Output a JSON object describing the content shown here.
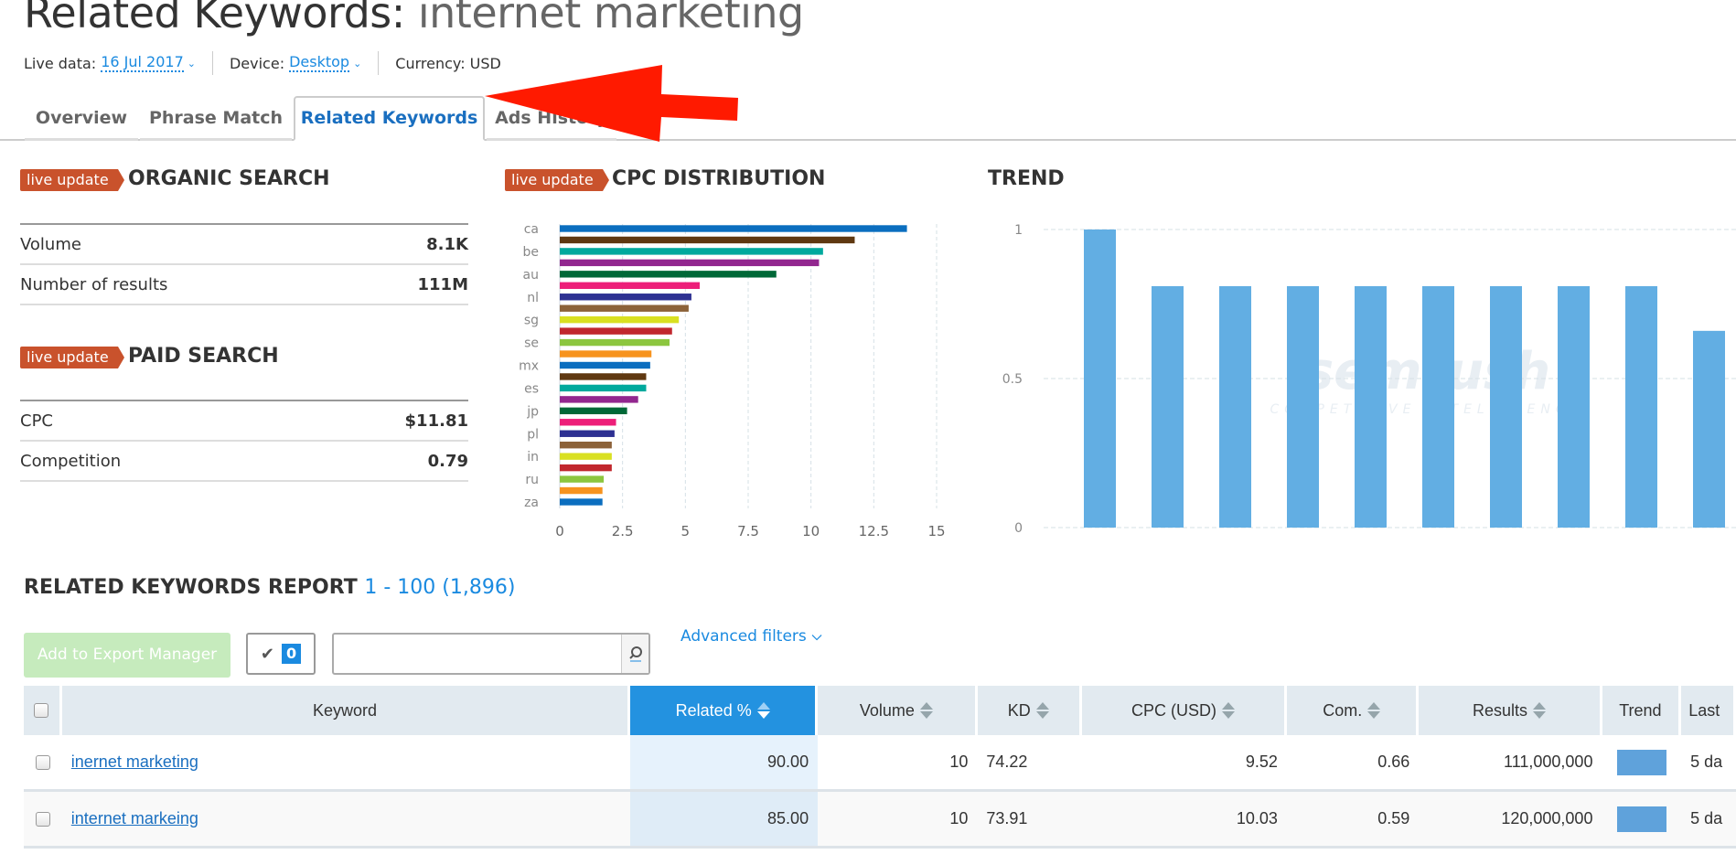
{
  "header": {
    "title_prefix": "Related Keywords: ",
    "title_keyword": "internet marketing",
    "live_data_label": "Live data:",
    "live_data_value": "16 Jul 2017",
    "device_label": "Device:",
    "device_value": "Desktop",
    "currency_label": "Currency: USD"
  },
  "tabs": [
    {
      "label": "Overview",
      "active": false
    },
    {
      "label": "Phrase Match",
      "active": false
    },
    {
      "label": "Related Keywords",
      "active": true
    },
    {
      "label": "Ads History",
      "active": false
    }
  ],
  "annotation": {
    "type": "red-arrow",
    "color": "#ff1a00",
    "points_to": "Related Keywords tab"
  },
  "badge_label": "live update",
  "organic": {
    "title": "ORGANIC SEARCH",
    "rows": [
      {
        "label": "Volume",
        "value": "8.1K"
      },
      {
        "label": "Number of results",
        "value": "111M"
      }
    ]
  },
  "paid": {
    "title": "PAID SEARCH",
    "rows": [
      {
        "label": "CPC",
        "value": "$11.81"
      },
      {
        "label": "Competition",
        "value": "0.79"
      }
    ]
  },
  "cpc_title": "CPC DISTRIBUTION",
  "trend_title": "TREND",
  "chart_data": [
    {
      "type": "bar",
      "orientation": "horizontal",
      "title": "CPC DISTRIBUTION",
      "category_labels_shown": [
        "ca",
        "be",
        "au",
        "nl",
        "sg",
        "se",
        "mx",
        "es",
        "jp",
        "pl",
        "in",
        "ru",
        "za"
      ],
      "values": [
        13.82,
        11.74,
        10.48,
        10.32,
        8.62,
        5.57,
        5.24,
        5.13,
        4.74,
        4.47,
        4.37,
        3.65,
        3.6,
        3.44,
        3.44,
        3.12,
        2.68,
        2.24,
        2.18,
        2.07,
        2.07,
        2.07,
        1.75,
        1.7,
        1.7
      ],
      "colors": [
        "#0b6ebf",
        "#5f3811",
        "#00a99d",
        "#92278f",
        "#006837",
        "#ed1e79",
        "#2e3192",
        "#8c6239",
        "#d9e021",
        "#c1272d",
        "#8cc63f",
        "#f7931e"
      ],
      "xticks": [
        "0",
        "2.5",
        "5",
        "7.5",
        "10",
        "12.5",
        "15"
      ],
      "xlim": [
        0,
        15
      ],
      "grid": true
    },
    {
      "type": "bar",
      "title": "TREND",
      "values": [
        1.0,
        0.81,
        0.81,
        0.81,
        0.81,
        0.81,
        0.81,
        0.81,
        0.81,
        0.66
      ],
      "color": "#62aee3",
      "yticks": [
        "0",
        "0.5",
        "1"
      ],
      "ylim": [
        0,
        1
      ],
      "grid": true,
      "watermark": "semrush COMPETITIVE INTELLIGENCE"
    }
  ],
  "report": {
    "title": "RELATED KEYWORDS REPORT",
    "range": "1 - 100 (1,896)",
    "export_button": "Add to Export Manager",
    "selected_count": "0",
    "search_placeholder": "",
    "advanced_filters": "Advanced filters",
    "columns": [
      "Keyword",
      "Related %",
      "Volume",
      "KD",
      "CPC (USD)",
      "Com.",
      "Results",
      "Trend",
      "Last"
    ],
    "rows": [
      {
        "keyword": "inernet marketing",
        "related": "90.00",
        "volume": "10",
        "kd": "74.22",
        "cpc": "9.52",
        "com": "0.66",
        "results": "111,000,000",
        "last": "5 da"
      },
      {
        "keyword": "internet markeing",
        "related": "85.00",
        "volume": "10",
        "kd": "73.91",
        "cpc": "10.03",
        "com": "0.59",
        "results": "120,000,000",
        "last": "5 da"
      }
    ]
  }
}
